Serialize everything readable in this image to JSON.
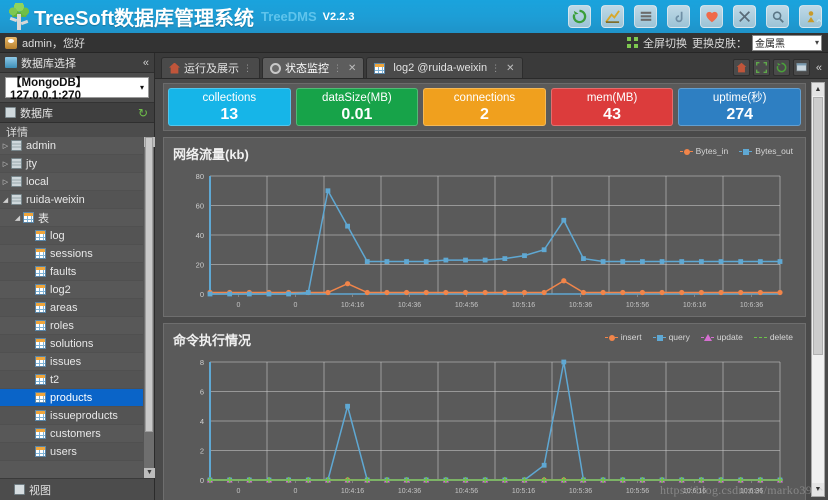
{
  "header": {
    "logo_icon": "tree-logo-icon",
    "title": "TreeSoft数据库管理系统",
    "subtitle": "TreeDMS",
    "version": "V2.2.3",
    "toolbar_icons": [
      {
        "name": "refresh-icon",
        "glyph": "↻"
      },
      {
        "name": "chart-icon",
        "glyph": "▨"
      },
      {
        "name": "list-icon",
        "glyph": "▤"
      },
      {
        "name": "moon-icon",
        "glyph": "☾"
      },
      {
        "name": "heart-icon",
        "glyph": "♥"
      },
      {
        "name": "tools-icon",
        "glyph": "✂"
      },
      {
        "name": "search-icon",
        "glyph": "🔍"
      },
      {
        "name": "person-icon",
        "glyph": "人"
      }
    ],
    "collapse_glyph": "⌃"
  },
  "userbar": {
    "user_text": "admin，您好",
    "fullscreen_label": "全屏切换",
    "skin_label": "更换皮肤：",
    "skin_value": "金属黑",
    "caret": "▾"
  },
  "sidebar": {
    "panel_title": "数据库选择",
    "collapse_glyph": "«",
    "db_connection": "【MongoDB】127.0.0.1:270",
    "db_caret": "▾",
    "section_title": "数据库",
    "refresh_glyph": "↻",
    "detail_label": "详情",
    "tree": [
      {
        "label": "admin",
        "icon": "database-icon",
        "indent": 0,
        "arrow": "▷",
        "selected": false
      },
      {
        "label": "jty",
        "icon": "database-icon",
        "indent": 0,
        "arrow": "▷",
        "selected": false
      },
      {
        "label": "local",
        "icon": "database-icon",
        "indent": 0,
        "arrow": "▷",
        "selected": false
      },
      {
        "label": "ruida-weixin",
        "icon": "database-icon",
        "indent": 0,
        "arrow": "◢",
        "selected": false
      },
      {
        "label": "表",
        "icon": "folder-table-icon",
        "indent": 1,
        "arrow": "◢",
        "selected": false
      },
      {
        "label": "log",
        "icon": "table-icon",
        "indent": 2,
        "arrow": "",
        "selected": false
      },
      {
        "label": "sessions",
        "icon": "table-icon",
        "indent": 2,
        "arrow": "",
        "selected": false
      },
      {
        "label": "faults",
        "icon": "table-icon",
        "indent": 2,
        "arrow": "",
        "selected": false
      },
      {
        "label": "log2",
        "icon": "table-icon",
        "indent": 2,
        "arrow": "",
        "selected": false
      },
      {
        "label": "areas",
        "icon": "table-icon",
        "indent": 2,
        "arrow": "",
        "selected": false
      },
      {
        "label": "roles",
        "icon": "table-icon",
        "indent": 2,
        "arrow": "",
        "selected": false
      },
      {
        "label": "solutions",
        "icon": "table-icon",
        "indent": 2,
        "arrow": "",
        "selected": false
      },
      {
        "label": "issues",
        "icon": "table-icon",
        "indent": 2,
        "arrow": "",
        "selected": false
      },
      {
        "label": "t2",
        "icon": "table-icon",
        "indent": 2,
        "arrow": "",
        "selected": false
      },
      {
        "label": "products",
        "icon": "table-icon",
        "indent": 2,
        "arrow": "",
        "selected": true
      },
      {
        "label": "issueproducts",
        "icon": "table-icon",
        "indent": 2,
        "arrow": "",
        "selected": false
      },
      {
        "label": "customers",
        "icon": "table-icon",
        "indent": 2,
        "arrow": "",
        "selected": false
      },
      {
        "label": "users",
        "icon": "table-icon",
        "indent": 2,
        "arrow": "",
        "selected": false
      }
    ],
    "views_label": "视图",
    "scroll_up": "▲",
    "scroll_down": "▼"
  },
  "tabs": [
    {
      "label": "运行及展示",
      "icon": "home-icon",
      "active": false,
      "closable": false
    },
    {
      "label": "状态监控",
      "icon": "monitor-icon",
      "active": true,
      "closable": true
    },
    {
      "label": "log2 @ruida-weixin",
      "icon": "table-icon",
      "active": false,
      "closable": true
    }
  ],
  "tab_tools": [
    {
      "name": "home-button",
      "glyph": "⌂"
    },
    {
      "name": "fullscreen-button",
      "glyph": "⛶"
    },
    {
      "name": "refresh-button",
      "glyph": "↻"
    },
    {
      "name": "window-button",
      "glyph": "▤"
    }
  ],
  "tab_collapse": "«",
  "stat_cards": [
    {
      "label": "collections",
      "value": "13",
      "color": "#16b5e8"
    },
    {
      "label": "dataSize(MB)",
      "value": "0.01",
      "color": "#17a349"
    },
    {
      "label": "connections",
      "value": "2",
      "color": "#f0a01e"
    },
    {
      "label": "mem(MB)",
      "value": "43",
      "color": "#dc3c3c"
    },
    {
      "label": "uptime(秒)",
      "value": "274",
      "color": "#2e7fc2"
    }
  ],
  "chart_data": [
    {
      "type": "line",
      "title": "网络流量(kb)",
      "xlabel": "",
      "ylabel": "",
      "ylim": [
        0,
        80
      ],
      "yticks": [
        0,
        20,
        40,
        60,
        80
      ],
      "grid": true,
      "legend_position": "top-right",
      "x": [
        "0",
        "0",
        "10:4:16",
        "10:4:36",
        "10:4:56",
        "10:5:16",
        "10:5:36",
        "10:5:56",
        "10:6:16",
        "10:6:36"
      ],
      "xticks": [
        "0",
        "0",
        "10:4:16",
        "10:4:36",
        "10:4:56",
        "10:5:16",
        "10:5:36",
        "10:5:56",
        "10:6:16",
        "10:6:36"
      ],
      "series": [
        {
          "name": "Bytes_in",
          "color": "#f1854a",
          "values": [
            1,
            1,
            1,
            1,
            1,
            1,
            1,
            1,
            1,
            1,
            1,
            1,
            1,
            1,
            1,
            1,
            1,
            1,
            1,
            1,
            1,
            1,
            1,
            1,
            1,
            1,
            1,
            1,
            1,
            1
          ]
        },
        {
          "name": "Bytes_out",
          "color": "#5fa8d3",
          "values": [
            0,
            0,
            0,
            0,
            0,
            1,
            70,
            46,
            22,
            22,
            22,
            22,
            23,
            23,
            23,
            24,
            26,
            30,
            50,
            24,
            22,
            22,
            22,
            22,
            22,
            22,
            22,
            22,
            22,
            22
          ]
        }
      ],
      "extra_series_note": "Bytes_in has small bumps to ~7 at index 7 and ~9 at index 18"
    },
    {
      "type": "line",
      "title": "命令执行情况",
      "xlabel": "",
      "ylabel": "",
      "ylim": [
        0,
        8
      ],
      "yticks": [
        0,
        2,
        4,
        6,
        8
      ],
      "grid": true,
      "legend_position": "top-right",
      "x": [
        "0",
        "0",
        "10:4:16",
        "10:4:36",
        "10:4:56",
        "10:5:16",
        "10:5:36",
        "10:5:56",
        "10:6:16",
        "10:6:36"
      ],
      "series": [
        {
          "name": "insert",
          "color": "#f1854a",
          "values": [
            0,
            0,
            0,
            0,
            0,
            0,
            0,
            0,
            0,
            0,
            0,
            0,
            0,
            0,
            0,
            0,
            0,
            0,
            0,
            0,
            0,
            0,
            0,
            0,
            0,
            0,
            0,
            0,
            0,
            0
          ]
        },
        {
          "name": "query",
          "color": "#5fa8d3",
          "values": [
            0,
            0,
            0,
            0,
            0,
            0,
            0,
            5,
            0,
            0,
            0,
            0,
            0,
            0,
            0,
            0,
            0,
            1,
            8,
            0,
            0,
            0,
            0,
            0,
            0,
            0,
            0,
            0,
            0,
            0
          ]
        },
        {
          "name": "update",
          "color": "#d56fd0",
          "values": [
            0,
            0,
            0,
            0,
            0,
            0,
            0,
            0,
            0,
            0,
            0,
            0,
            0,
            0,
            0,
            0,
            0,
            0,
            0,
            0,
            0,
            0,
            0,
            0,
            0,
            0,
            0,
            0,
            0,
            0
          ]
        },
        {
          "name": "delete",
          "color": "#6cc24a",
          "values": [
            0,
            0,
            0,
            0,
            0,
            0,
            0,
            0,
            0,
            0,
            0,
            0,
            0,
            0,
            0,
            0,
            0,
            0,
            0,
            0,
            0,
            0,
            0,
            0,
            0,
            0,
            0,
            0,
            0,
            0
          ]
        }
      ]
    }
  ],
  "watermark": "https://blog.csdn.net/marko39",
  "scroll": {
    "up": "▲",
    "down": "▼"
  },
  "corner_collapse": "⌃"
}
